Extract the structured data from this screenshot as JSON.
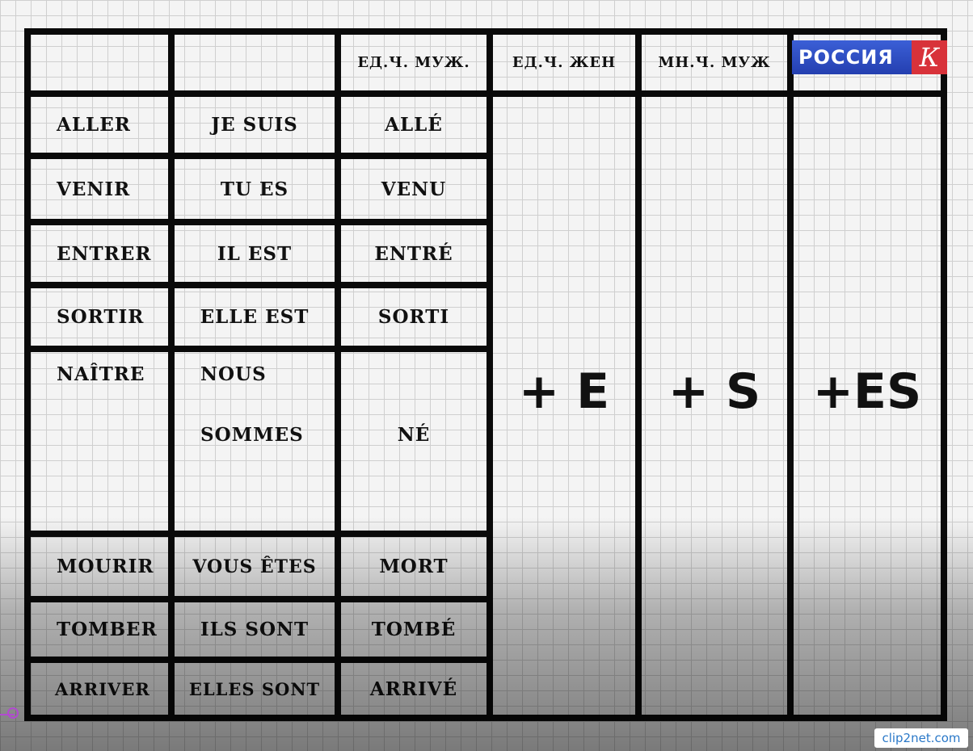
{
  "header": {
    "col3": "ЕД.Ч. МУЖ.",
    "col4": "ЕД.Ч. ЖЕН",
    "col5": "МН.Ч. МУЖ"
  },
  "rows": [
    {
      "verb": "ALLER",
      "pronoun": "JE SUIS",
      "participle": "ALLÉ"
    },
    {
      "verb": "VENIR",
      "pronoun": "TU ES",
      "participle": "VENU"
    },
    {
      "verb": "ENTRER",
      "pronoun": "IL EST",
      "participle": "ENTRÉ"
    },
    {
      "verb": "SORTIR",
      "pronoun": "ELLE EST",
      "participle": "SORTI"
    },
    {
      "verb": "NAÎTRE",
      "pronoun_line1": "NOUS",
      "pronoun_line2": "SOMMES",
      "participle": "NÉ"
    },
    {
      "verb": "MOURIR",
      "pronoun": "VOUS ÊTES",
      "participle": "MORT"
    },
    {
      "verb": "TOMBER",
      "pronoun": "ILS SONT",
      "participle": "TOMBÉ"
    },
    {
      "verb": "ARRIVER",
      "pronoun": "ELLES SONT",
      "participle": "ARRIVÉ"
    }
  ],
  "suffixes": {
    "fem_singular": "+ E",
    "masc_plural": "+ S",
    "fem_plural": "+ES"
  },
  "logo": {
    "text": "РОССИЯ",
    "letter": "К"
  },
  "watermark": "clip2net.com"
}
